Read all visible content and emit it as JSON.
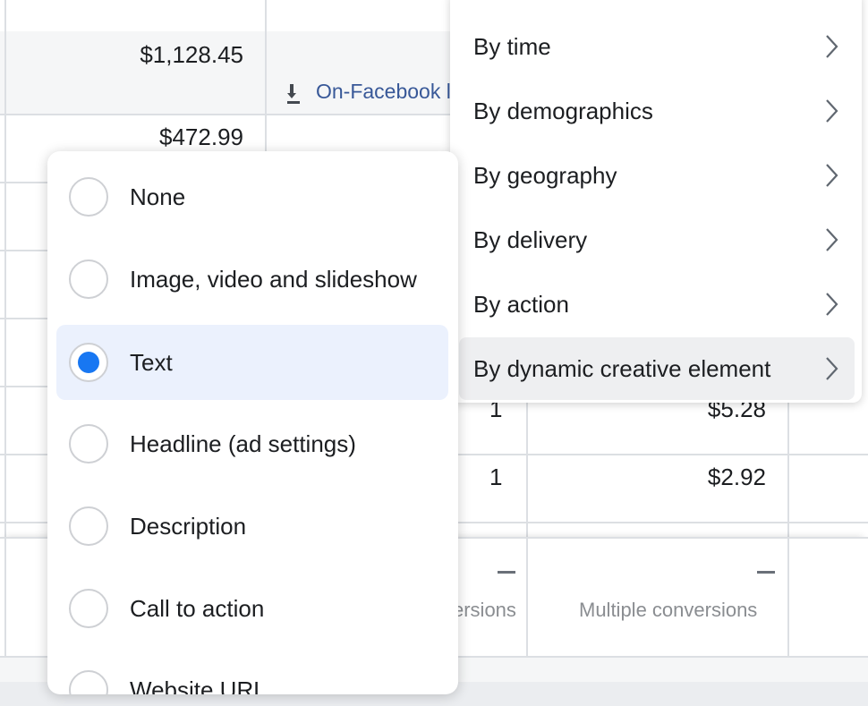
{
  "table": {
    "amounts": [
      "$1,128.45",
      "$472.99",
      "$5.28",
      "$2.92"
    ],
    "ones": [
      "1",
      "1"
    ],
    "link_text": "On-Facebook l",
    "footer": {
      "conversions_partial": "ersions",
      "multiple_conversions": "Multiple conversions"
    }
  },
  "breakdown_menu": {
    "items": [
      {
        "label": "By time"
      },
      {
        "label": "By demographics"
      },
      {
        "label": "By geography"
      },
      {
        "label": "By delivery"
      },
      {
        "label": "By action"
      },
      {
        "label": "By dynamic creative element",
        "active": true
      }
    ]
  },
  "dynamic_creative_menu": {
    "selected": "Text",
    "options": [
      {
        "label": "None"
      },
      {
        "label": "Image, video and slideshow"
      },
      {
        "label": "Text"
      },
      {
        "label": "Headline (ad settings)"
      },
      {
        "label": "Description"
      },
      {
        "label": "Call to action"
      },
      {
        "label": "Website URL"
      }
    ]
  },
  "colors": {
    "accent": "#1877f2",
    "selected_row_bg": "#ebf1fd",
    "link": "#385898"
  }
}
